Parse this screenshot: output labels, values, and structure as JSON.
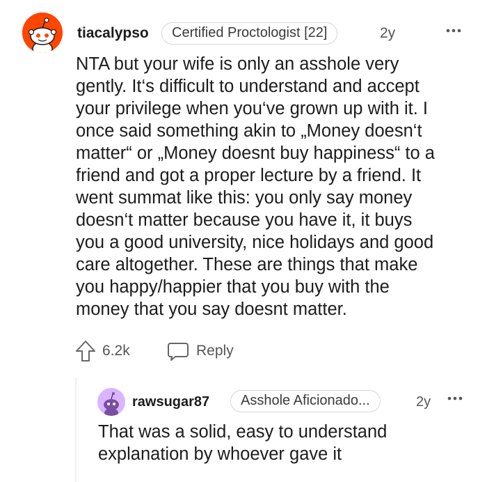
{
  "comment": {
    "username": "tiacalypso",
    "flair": "Certified Proctologist [22]",
    "age": "2y",
    "body": "NTA but your wife is only an asshole very\ngently. It‘s difficult to understand and accept\nyour privilege when you‘ve grown up with it. I\nonce said something akin to „Money doesn‘t\nmatter“ or „Money doesnt buy happiness“ to a\nfriend and got a proper lecture by a friend. It\nwent summat like this: you only say money\ndoesn‘t matter because you have it, it buys\nyou a good university, nice holidays and good\ncare altogether. These are things that make\nyou happy/happier that you buy with the\nmoney that you say doesnt matter.",
    "upvotes": "6.2k",
    "reply_label": "Reply",
    "avatar_color": "#ff4500"
  },
  "reply": {
    "username": "rawsugar87",
    "flair": "Asshole Aficionado...",
    "age": "2y",
    "body": "That was a solid, easy to understand\nexplanation by whoever gave it",
    "avatar_color": "#d9b5ff"
  },
  "icons": {
    "upvote": "upvote-arrow-icon",
    "reply": "speech-bubble-icon",
    "more": "ellipsis-icon"
  }
}
